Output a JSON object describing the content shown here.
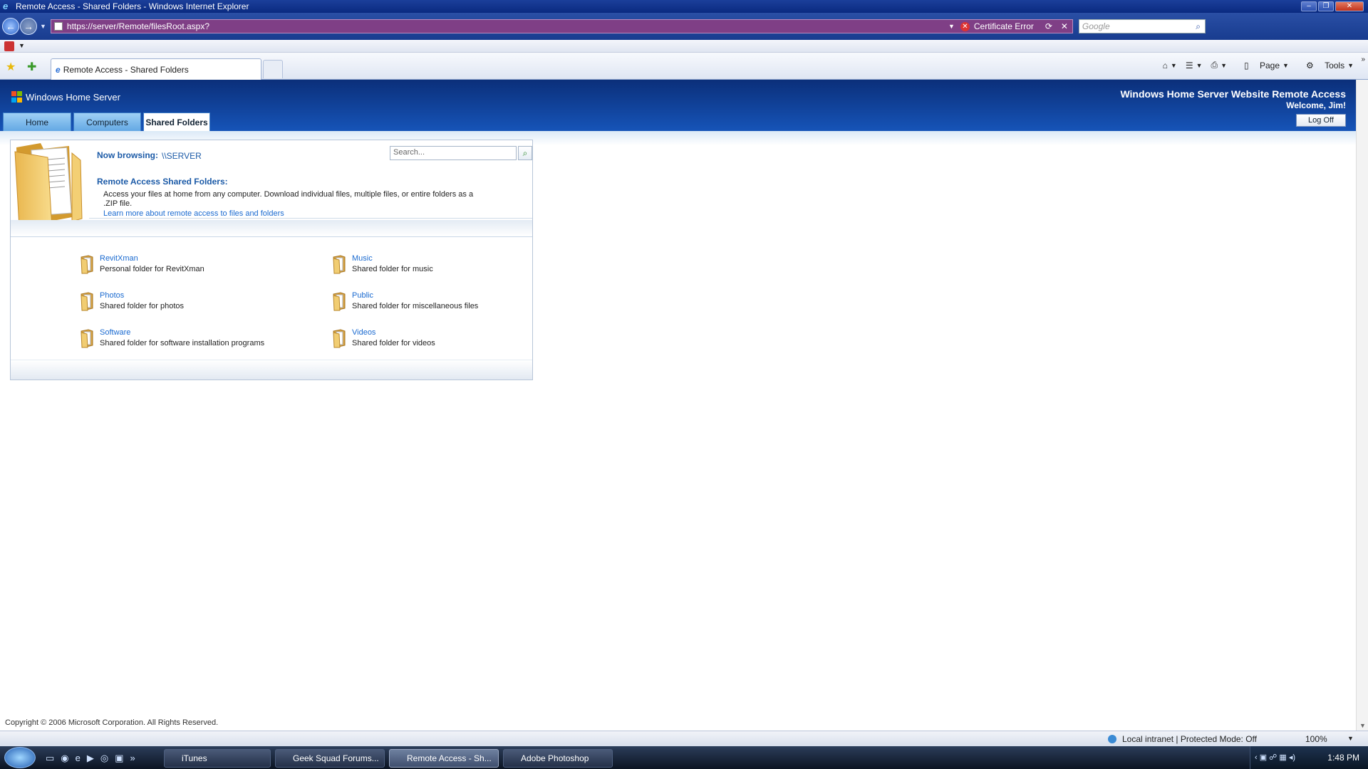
{
  "window": {
    "title": "Remote Access - Shared Folders - Windows Internet Explorer"
  },
  "address_bar": {
    "url": "https://server/Remote/filesRoot.aspx?",
    "cert_error": "Certificate Error",
    "search_placeholder": "Google"
  },
  "tabs": {
    "active_tab_title": "Remote Access - Shared Folders"
  },
  "command_bar": {
    "page_label": "Page",
    "tools_label": "Tools"
  },
  "site": {
    "logo_text": "Windows Home Server",
    "site_title": "Windows Home Server Website Remote Access",
    "welcome": "Welcome, Jim!",
    "logoff_label": "Log Off",
    "nav_tabs": [
      {
        "label": "Home"
      },
      {
        "label": "Computers"
      },
      {
        "label": "Shared Folders"
      }
    ],
    "active_nav": "Shared Folders"
  },
  "browser_panel": {
    "now_browsing_label": "Now browsing:",
    "now_browsing_path": "\\\\SERVER",
    "search_placeholder": "Search...",
    "intro_heading": "Remote Access Shared Folders:",
    "intro_text": "Access your files at home from any computer. Download individual files, multiple files, or entire folders as a .ZIP file.",
    "learn_more_link": "Learn more about remote access to files and folders"
  },
  "folders": [
    {
      "name": "RevitXman",
      "description": "Personal folder for RevitXman"
    },
    {
      "name": "Music",
      "description": "Shared folder for music"
    },
    {
      "name": "Photos",
      "description": "Shared folder for photos"
    },
    {
      "name": "Public",
      "description": "Shared folder for miscellaneous files"
    },
    {
      "name": "Software",
      "description": "Shared folder for software installation programs"
    },
    {
      "name": "Videos",
      "description": "Shared folder for videos"
    }
  ],
  "footer": {
    "copyright": "Copyright © 2006 Microsoft Corporation. All Rights Reserved."
  },
  "status_bar": {
    "zone": "Local intranet | Protected Mode: Off",
    "zoom": "100%"
  },
  "taskbar": {
    "tasks": [
      {
        "label": "iTunes"
      },
      {
        "label": "Geek Squad Forums..."
      },
      {
        "label": "Remote Access - Sh..."
      },
      {
        "label": "Adobe Photoshop"
      }
    ],
    "clock": "1:48 PM"
  },
  "colors": {
    "header_blue": "#0b2f7a",
    "link_blue": "#1a6ad0",
    "heading_blue": "#1b5aa7",
    "address_bar_error": "#7f3f86"
  }
}
